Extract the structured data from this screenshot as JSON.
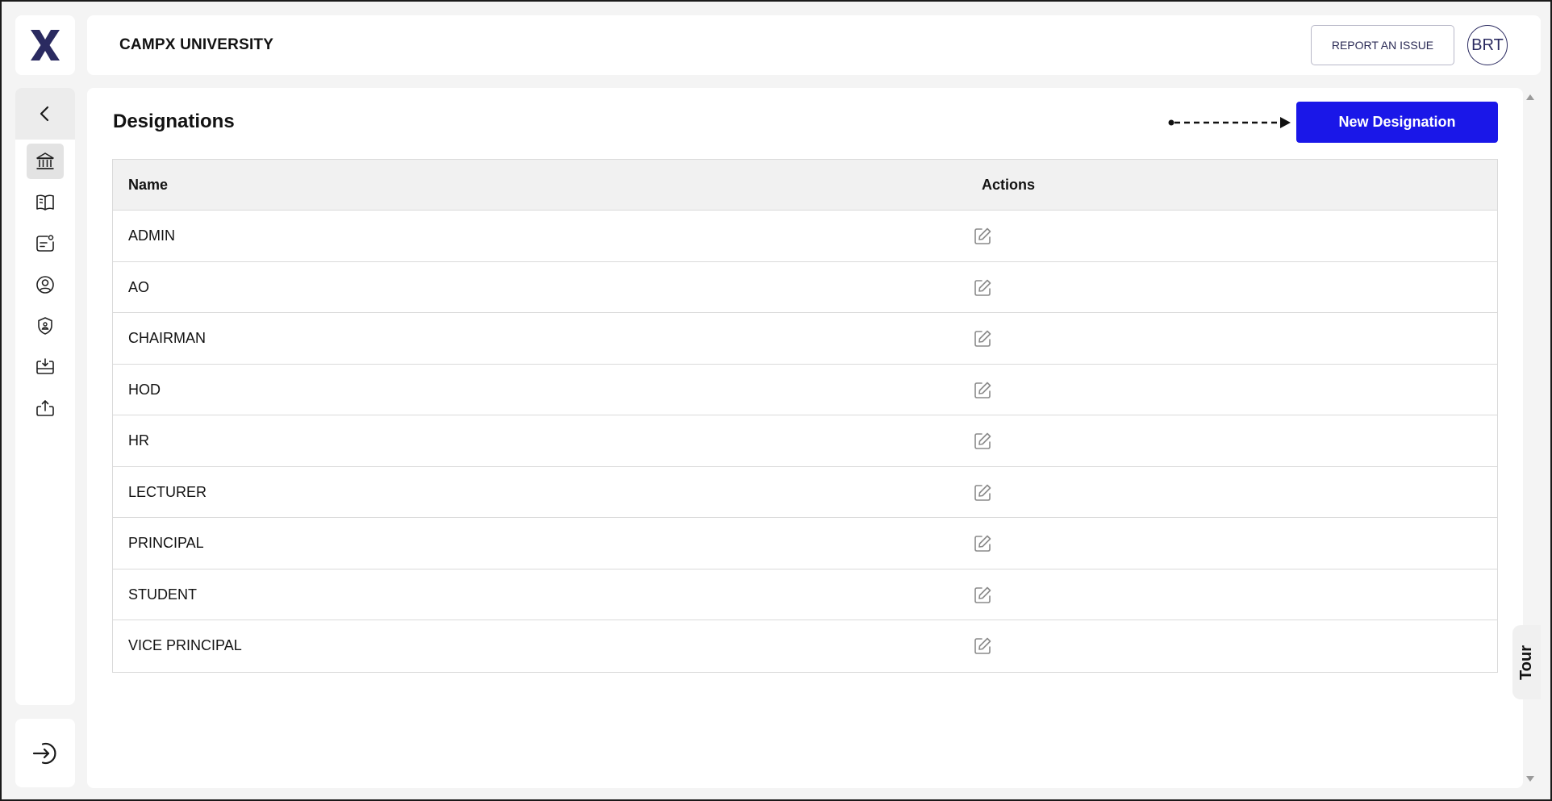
{
  "header": {
    "brand": "CAMPX UNIVERSITY",
    "report_label": "REPORT AN ISSUE",
    "avatar_initials": "BRT"
  },
  "sidebar": {
    "items": [
      {
        "icon": "institution-icon",
        "active": true
      },
      {
        "icon": "book-icon",
        "active": false
      },
      {
        "icon": "id-card-icon",
        "active": false
      },
      {
        "icon": "user-circle-icon",
        "active": false
      },
      {
        "icon": "shield-user-icon",
        "active": false
      },
      {
        "icon": "inbox-download-icon",
        "active": false
      },
      {
        "icon": "upload-icon",
        "active": false
      }
    ]
  },
  "page": {
    "title": "Designations",
    "new_button_label": "New Designation"
  },
  "table": {
    "columns": [
      "Name",
      "Actions"
    ],
    "rows": [
      {
        "name": "ADMIN"
      },
      {
        "name": "AO"
      },
      {
        "name": "CHAIRMAN"
      },
      {
        "name": "HOD"
      },
      {
        "name": "HR"
      },
      {
        "name": "LECTURER"
      },
      {
        "name": "PRINCIPAL"
      },
      {
        "name": "STUDENT"
      },
      {
        "name": "VICE PRINCIPAL"
      }
    ]
  },
  "tour": {
    "label": "Tour"
  },
  "colors": {
    "primary": "#1a17e8",
    "brand_dark": "#2a2a60"
  }
}
